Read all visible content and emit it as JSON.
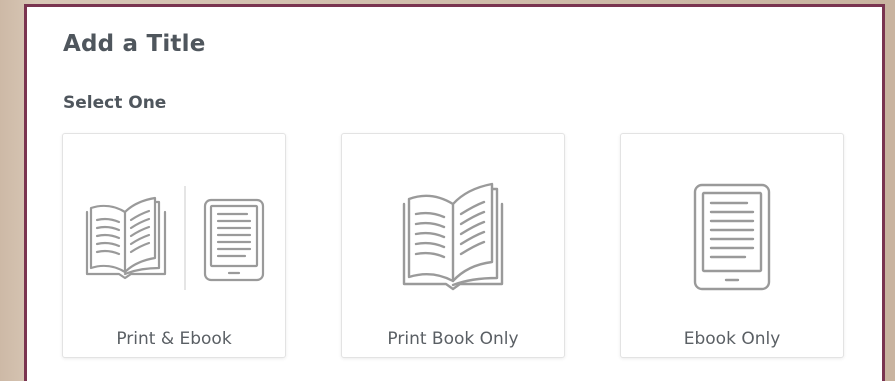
{
  "dialog": {
    "title": "Add a Title",
    "subtitle": "Select One"
  },
  "options": [
    {
      "label": "Print & Ebook",
      "icons": [
        "open-book-icon",
        "ereader-icon"
      ]
    },
    {
      "label": "Print Book Only",
      "icons": [
        "open-book-icon"
      ]
    },
    {
      "label": "Ebook Only",
      "icons": [
        "ereader-icon"
      ]
    }
  ],
  "colors": {
    "modal_border": "#7a3450",
    "heading_text": "#4f565d",
    "label_text": "#5a5f64",
    "icon_stroke": "#9a9a9a"
  }
}
